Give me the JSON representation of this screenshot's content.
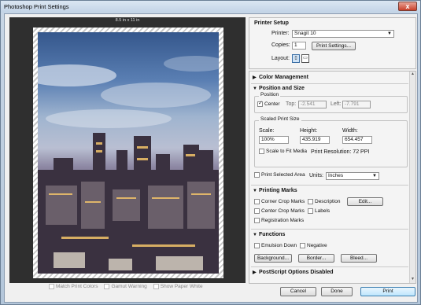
{
  "window": {
    "title": "Photoshop Print Settings",
    "close": "x"
  },
  "preview": {
    "paper_size": "8.5 in x 11 in"
  },
  "bottom_options": [
    {
      "label": "Match Print Colors",
      "checked": false
    },
    {
      "label": "Gamut Warning",
      "checked": false
    },
    {
      "label": "Show Paper White",
      "checked": false
    }
  ],
  "printer_setup": {
    "heading": "Printer Setup",
    "printer_label": "Printer:",
    "printer_value": "Snagit 10",
    "copies_label": "Copies:",
    "copies_value": "1",
    "print_settings_button": "Print Settings...",
    "layout_label": "Layout:"
  },
  "sections": {
    "color_management": "Color Management",
    "position_and_size": "Position and Size",
    "printing_marks": "Printing Marks",
    "functions": "Functions",
    "postscript": "PostScript Options Disabled"
  },
  "position": {
    "group_label": "Position",
    "center_label": "Center",
    "center_checked": true,
    "top_label": "Top:",
    "top_value": "-2.541",
    "left_label": "Left:",
    "left_value": "-7.791"
  },
  "scaled": {
    "group_label": "Scaled Print Size",
    "scale_label": "Scale:",
    "scale_value": "100%",
    "height_label": "Height:",
    "height_value": "435.919",
    "width_label": "Width:",
    "width_value": "654.457",
    "fit_media_label": "Scale to Fit Media",
    "resolution_text": "Print Resolution: 72 PPI"
  },
  "print_selected": {
    "label": "Print Selected Area",
    "units_label": "Units:",
    "units_value": "Inches"
  },
  "marks": {
    "corner_crop": "Corner Crop Marks",
    "center_crop": "Center Crop Marks",
    "registration": "Registration Marks",
    "description": "Description",
    "labels": "Labels",
    "edit_button": "Edit..."
  },
  "functions": {
    "emulsion_down": "Emulsion Down",
    "negative": "Negative",
    "background_button": "Background...",
    "border_button": "Border...",
    "bleed_button": "Bleed..."
  },
  "footer": {
    "cancel": "Cancel",
    "done": "Done",
    "print": "Print"
  },
  "icons": {
    "expand": "▶",
    "collapse": "▼",
    "dropdown": "▼",
    "portrait": "▯",
    "landscape": "▭",
    "scroll_up": "▲",
    "scroll_down": "▼"
  }
}
